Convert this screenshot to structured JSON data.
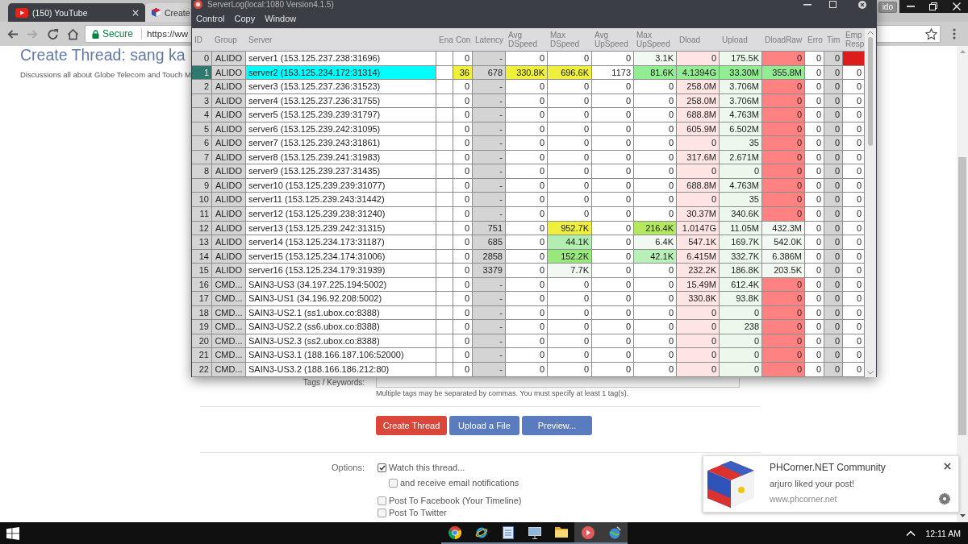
{
  "browser": {
    "tabs": [
      {
        "label": "(150) YouTube",
        "selected": false
      },
      {
        "label": "Create",
        "selected": true
      }
    ],
    "profile": "ido",
    "nav_buttons": [
      {
        "kind": "back",
        "disabled": false
      },
      {
        "kind": "forward",
        "disabled": true
      },
      {
        "kind": "reload",
        "disabled": false
      },
      {
        "kind": "home",
        "disabled": false
      }
    ],
    "address": {
      "security": "Secure",
      "url": "https://ww"
    }
  },
  "page": {
    "title": "Create Thread: sang ka",
    "description": "Discussions all about Globe Telecom and Touch M",
    "tags_label": "Tags / Keywords:",
    "tags_hint": "Multiple tags may be separated by commas. You must specify at least 1 tag(s).",
    "buttons": [
      {
        "label": "Create Thread",
        "kind": "primary"
      },
      {
        "label": "Upload a File",
        "kind": "secondary"
      },
      {
        "label": "Preview...",
        "kind": "secondary"
      }
    ],
    "options_label": "Options:",
    "options": [
      {
        "label": "Watch this thread...",
        "checked": true,
        "children": [
          {
            "label": "and receive email notifications",
            "checked": false
          }
        ]
      },
      {
        "label": "Post To Facebook (Your Timeline)",
        "checked": false
      },
      {
        "label": "Post To Twitter",
        "checked": false
      }
    ]
  },
  "serverlog": {
    "title": "ServerLog(local:1080 Version4.1.5)",
    "menu": [
      "Control",
      "Copy",
      "Window"
    ],
    "table": {
      "columns": [
        {
          "label": "ID",
          "kind": "index"
        },
        {
          "label": "Group",
          "kind": "label"
        },
        {
          "label": "Server",
          "kind": "text"
        },
        {
          "label": "Ena",
          "kind": "blank"
        },
        {
          "label": "Con",
          "kind": "number"
        },
        {
          "label": "Latency",
          "kind": "shaded"
        },
        {
          "label": "Avg DSpeed",
          "kind": "number"
        },
        {
          "label": "Max DSpeed",
          "kind": "number"
        },
        {
          "label": "Avg UpSpeed",
          "kind": "number"
        },
        {
          "label": "Max UpSpeed",
          "kind": "number"
        },
        {
          "label": "Dload",
          "kind": "number"
        },
        {
          "label": "Upload",
          "kind": "number"
        },
        {
          "label": "DloadRaw",
          "kind": "number"
        },
        {
          "label": "Erro",
          "kind": "number"
        },
        {
          "label": "Tim",
          "kind": "shaded"
        },
        {
          "label": "Emp Resp",
          "kind": "number"
        }
      ],
      "rows": [
        {
          "selected": false,
          "cells": [
            {
              "text": "0"
            },
            {
              "text": "ALIDO"
            },
            {
              "text": "server1 (153.125.237.238:31696)"
            },
            {
              "text": ""
            },
            {
              "text": "0"
            },
            {
              "text": "-"
            },
            {
              "text": "0"
            },
            {
              "text": "0"
            },
            {
              "text": "0"
            },
            {
              "text": "3.1K",
              "color": "#f2f9f2"
            },
            {
              "text": "0",
              "color": "#ffe4e4"
            },
            {
              "text": "175.5K",
              "color": "#ebf8eb"
            },
            {
              "text": "0",
              "color": "#ff8282"
            },
            {
              "text": "0"
            },
            {
              "text": "0"
            },
            {
              "color": "#dd1c1c"
            }
          ]
        },
        {
          "selected": true,
          "cells": [
            {
              "text": "1"
            },
            {
              "text": "ALIDO"
            },
            {
              "text": "server2 (153.125.234.172:31314)",
              "color": "#00ffff"
            },
            {
              "text": ""
            },
            {
              "text": "36",
              "color": "#eef03c"
            },
            {
              "text": "678"
            },
            {
              "text": "330.8K",
              "color": "#eef03c"
            },
            {
              "text": "696.6K",
              "color": "#eef03c"
            },
            {
              "text": "1173"
            },
            {
              "text": "81.6K",
              "color": "#92ec92"
            },
            {
              "text": "4.1394G",
              "color": "#92ec92"
            },
            {
              "text": "33.30M",
              "color": "#92ec92"
            },
            {
              "text": "355.8M",
              "color": "#92ec92"
            },
            {
              "text": "0"
            },
            {
              "text": "0"
            },
            {
              "text": "0"
            }
          ]
        },
        {
          "selected": false,
          "cells": [
            {
              "text": "2"
            },
            {
              "text": "ALIDO"
            },
            {
              "text": "server3 (153.125.237.236:31523)"
            },
            {
              "text": ""
            },
            {
              "text": "0"
            },
            {
              "text": "-"
            },
            {
              "text": "0"
            },
            {
              "text": "0"
            },
            {
              "text": "0"
            },
            {
              "text": "0"
            },
            {
              "text": "258.0M",
              "color": "#ffe4e4"
            },
            {
              "text": "3.706M",
              "color": "#ebf8eb"
            },
            {
              "text": "0",
              "color": "#ff8282"
            },
            {
              "text": "0"
            },
            {
              "text": "0"
            },
            {
              "text": "0"
            }
          ]
        },
        {
          "selected": false,
          "cells": [
            {
              "text": "3"
            },
            {
              "text": "ALIDO"
            },
            {
              "text": "server4 (153.125.237.236:31755)"
            },
            {
              "text": ""
            },
            {
              "text": "0"
            },
            {
              "text": "-"
            },
            {
              "text": "0"
            },
            {
              "text": "0"
            },
            {
              "text": "0"
            },
            {
              "text": "0"
            },
            {
              "text": "258.0M",
              "color": "#ffe4e4"
            },
            {
              "text": "3.706M",
              "color": "#ebf8eb"
            },
            {
              "text": "0",
              "color": "#ff8282"
            },
            {
              "text": "0"
            },
            {
              "text": "0"
            },
            {
              "text": "0"
            }
          ]
        },
        {
          "selected": false,
          "cells": [
            {
              "text": "4"
            },
            {
              "text": "ALIDO"
            },
            {
              "text": "server5 (153.125.239.239:31797)"
            },
            {
              "text": ""
            },
            {
              "text": "0"
            },
            {
              "text": "-"
            },
            {
              "text": "0"
            },
            {
              "text": "0"
            },
            {
              "text": "0"
            },
            {
              "text": "0"
            },
            {
              "text": "688.8M",
              "color": "#ffe4e4"
            },
            {
              "text": "4.763M",
              "color": "#ebf8eb"
            },
            {
              "text": "0",
              "color": "#ff8282"
            },
            {
              "text": "0"
            },
            {
              "text": "0"
            },
            {
              "text": "0"
            }
          ]
        },
        {
          "selected": false,
          "cells": [
            {
              "text": "5"
            },
            {
              "text": "ALIDO"
            },
            {
              "text": "server6 (153.125.239.242:31095)"
            },
            {
              "text": ""
            },
            {
              "text": "0"
            },
            {
              "text": "-"
            },
            {
              "text": "0"
            },
            {
              "text": "0"
            },
            {
              "text": "0"
            },
            {
              "text": "0"
            },
            {
              "text": "605.9M",
              "color": "#ffe4e4"
            },
            {
              "text": "6.502M",
              "color": "#ebf8eb"
            },
            {
              "text": "0",
              "color": "#ff8282"
            },
            {
              "text": "0"
            },
            {
              "text": "0"
            },
            {
              "text": "0"
            }
          ]
        },
        {
          "selected": false,
          "cells": [
            {
              "text": "6"
            },
            {
              "text": "ALIDO"
            },
            {
              "text": "server7 (153.125.239.243:31861)"
            },
            {
              "text": ""
            },
            {
              "text": "0"
            },
            {
              "text": "-"
            },
            {
              "text": "0"
            },
            {
              "text": "0"
            },
            {
              "text": "0"
            },
            {
              "text": "0"
            },
            {
              "text": "0",
              "color": "#ffe4e4"
            },
            {
              "text": "35",
              "color": "#ebf8eb"
            },
            {
              "text": "0",
              "color": "#ff8282"
            },
            {
              "text": "0"
            },
            {
              "text": "0"
            },
            {
              "text": "0"
            }
          ]
        },
        {
          "selected": false,
          "cells": [
            {
              "text": "7"
            },
            {
              "text": "ALIDO"
            },
            {
              "text": "server8 (153.125.239.241:31983)"
            },
            {
              "text": ""
            },
            {
              "text": "0"
            },
            {
              "text": "-"
            },
            {
              "text": "0"
            },
            {
              "text": "0"
            },
            {
              "text": "0"
            },
            {
              "text": "0"
            },
            {
              "text": "317.6M",
              "color": "#ffe4e4"
            },
            {
              "text": "2.671M",
              "color": "#ebf8eb"
            },
            {
              "text": "0",
              "color": "#ff8282"
            },
            {
              "text": "0"
            },
            {
              "text": "0"
            },
            {
              "text": "0"
            }
          ]
        },
        {
          "selected": false,
          "cells": [
            {
              "text": "8"
            },
            {
              "text": "ALIDO"
            },
            {
              "text": "server9 (153.125.239.237:31435)"
            },
            {
              "text": ""
            },
            {
              "text": "0"
            },
            {
              "text": "-"
            },
            {
              "text": "0"
            },
            {
              "text": "0"
            },
            {
              "text": "0"
            },
            {
              "text": "0"
            },
            {
              "text": "0",
              "color": "#ffe4e4"
            },
            {
              "text": "0",
              "color": "#ebf8eb"
            },
            {
              "text": "0",
              "color": "#ff8282"
            },
            {
              "text": "0"
            },
            {
              "text": "0"
            },
            {
              "text": "0"
            }
          ]
        },
        {
          "selected": false,
          "cells": [
            {
              "text": "9"
            },
            {
              "text": "ALIDO"
            },
            {
              "text": "server10 (153.125.239.239:31077)"
            },
            {
              "text": ""
            },
            {
              "text": "0"
            },
            {
              "text": "-"
            },
            {
              "text": "0"
            },
            {
              "text": "0"
            },
            {
              "text": "0"
            },
            {
              "text": "0"
            },
            {
              "text": "688.8M",
              "color": "#ffe4e4"
            },
            {
              "text": "4.763M",
              "color": "#ebf8eb"
            },
            {
              "text": "0",
              "color": "#ff8282"
            },
            {
              "text": "0"
            },
            {
              "text": "0"
            },
            {
              "text": "0"
            }
          ]
        },
        {
          "selected": false,
          "cells": [
            {
              "text": "10"
            },
            {
              "text": "ALIDO"
            },
            {
              "text": "server11 (153.125.239.243:31442)"
            },
            {
              "text": ""
            },
            {
              "text": "0"
            },
            {
              "text": "-"
            },
            {
              "text": "0"
            },
            {
              "text": "0"
            },
            {
              "text": "0"
            },
            {
              "text": "0"
            },
            {
              "text": "0",
              "color": "#ffe4e4"
            },
            {
              "text": "35",
              "color": "#ebf8eb"
            },
            {
              "text": "0",
              "color": "#ff8282"
            },
            {
              "text": "0"
            },
            {
              "text": "0"
            },
            {
              "text": "0"
            }
          ]
        },
        {
          "selected": false,
          "cells": [
            {
              "text": "11"
            },
            {
              "text": "ALIDO"
            },
            {
              "text": "server12 (153.125.239.238:31240)"
            },
            {
              "text": ""
            },
            {
              "text": "0"
            },
            {
              "text": "-"
            },
            {
              "text": "0"
            },
            {
              "text": "0"
            },
            {
              "text": "0"
            },
            {
              "text": "0"
            },
            {
              "text": "30.37M",
              "color": "#ffe4e4"
            },
            {
              "text": "340.6K",
              "color": "#ebf8eb"
            },
            {
              "text": "0",
              "color": "#ff8282"
            },
            {
              "text": "0"
            },
            {
              "text": "0"
            },
            {
              "text": "0"
            }
          ]
        },
        {
          "selected": false,
          "cells": [
            {
              "text": "12"
            },
            {
              "text": "ALIDO"
            },
            {
              "text": "server13 (153.125.239.242:31315)"
            },
            {
              "text": ""
            },
            {
              "text": "0"
            },
            {
              "text": "751"
            },
            {
              "text": "0"
            },
            {
              "text": "952.7K",
              "color": "#eef03c"
            },
            {
              "text": "0"
            },
            {
              "text": "216.4K",
              "color": "#b4e860"
            },
            {
              "text": "1.0147G",
              "color": "#ffe4e4"
            },
            {
              "text": "11.05M",
              "color": "#ebf8eb"
            },
            {
              "text": "432.3M",
              "color": "#f2f9f2"
            },
            {
              "text": "0"
            },
            {
              "text": "0"
            },
            {
              "text": "0"
            }
          ]
        },
        {
          "selected": false,
          "cells": [
            {
              "text": "13"
            },
            {
              "text": "ALIDO"
            },
            {
              "text": "server14 (153.125.234.173:31187)"
            },
            {
              "text": ""
            },
            {
              "text": "0"
            },
            {
              "text": "685"
            },
            {
              "text": "0"
            },
            {
              "text": "44.1K",
              "color": "#b2eeb2"
            },
            {
              "text": "0"
            },
            {
              "text": "6.4K",
              "color": "#f2f9f2"
            },
            {
              "text": "547.1K",
              "color": "#ffe4e4"
            },
            {
              "text": "169.7K",
              "color": "#ebf8eb"
            },
            {
              "text": "542.0K",
              "color": "#f2f9f2"
            },
            {
              "text": "0"
            },
            {
              "text": "0"
            },
            {
              "text": "0"
            }
          ]
        },
        {
          "selected": false,
          "cells": [
            {
              "text": "14"
            },
            {
              "text": "ALIDO"
            },
            {
              "text": "server15 (153.125.234.174:31006)"
            },
            {
              "text": ""
            },
            {
              "text": "0"
            },
            {
              "text": "2858"
            },
            {
              "text": "0"
            },
            {
              "text": "152.2K",
              "color": "#98e87c"
            },
            {
              "text": "0"
            },
            {
              "text": "42.1K",
              "color": "#b8f0b8"
            },
            {
              "text": "6.415M",
              "color": "#ffe4e4"
            },
            {
              "text": "332.7K",
              "color": "#ebf8eb"
            },
            {
              "text": "6.386M",
              "color": "#f2f9f2"
            },
            {
              "text": "0"
            },
            {
              "text": "0"
            },
            {
              "text": "0"
            }
          ]
        },
        {
          "selected": false,
          "cells": [
            {
              "text": "15"
            },
            {
              "text": "ALIDO"
            },
            {
              "text": "server16 (153.125.234.179:31939)"
            },
            {
              "text": ""
            },
            {
              "text": "0"
            },
            {
              "text": "3379"
            },
            {
              "text": "0"
            },
            {
              "text": "7.7K",
              "color": "#f2f9f2"
            },
            {
              "text": "0"
            },
            {
              "text": "0"
            },
            {
              "text": "232.2K",
              "color": "#ffe4e4"
            },
            {
              "text": "186.8K",
              "color": "#ebf8eb"
            },
            {
              "text": "203.5K",
              "color": "#f2f9f2"
            },
            {
              "text": "0"
            },
            {
              "text": "0"
            },
            {
              "text": "0"
            }
          ]
        },
        {
          "selected": false,
          "cells": [
            {
              "text": "16"
            },
            {
              "text": "CMD..."
            },
            {
              "text": "SAIN3-US3 (34.197.225.194:5002)"
            },
            {
              "text": ""
            },
            {
              "text": "0"
            },
            {
              "text": "-"
            },
            {
              "text": "0"
            },
            {
              "text": "0"
            },
            {
              "text": "0"
            },
            {
              "text": "0"
            },
            {
              "text": "15.49M",
              "color": "#ffe4e4"
            },
            {
              "text": "612.4K",
              "color": "#ebf8eb"
            },
            {
              "text": "0",
              "color": "#ff8282"
            },
            {
              "text": "0"
            },
            {
              "text": "0"
            },
            {
              "text": "0"
            }
          ]
        },
        {
          "selected": false,
          "cells": [
            {
              "text": "17"
            },
            {
              "text": "CMD..."
            },
            {
              "text": "SAIN3-US1 (34.196.92.208:5002)"
            },
            {
              "text": ""
            },
            {
              "text": "0"
            },
            {
              "text": "-"
            },
            {
              "text": "0"
            },
            {
              "text": "0"
            },
            {
              "text": "0"
            },
            {
              "text": "0"
            },
            {
              "text": "330.8K",
              "color": "#ffe4e4"
            },
            {
              "text": "93.8K",
              "color": "#ebf8eb"
            },
            {
              "text": "0",
              "color": "#ff8282"
            },
            {
              "text": "0"
            },
            {
              "text": "0"
            },
            {
              "text": "0"
            }
          ]
        },
        {
          "selected": false,
          "cells": [
            {
              "text": "18"
            },
            {
              "text": "CMD..."
            },
            {
              "text": "SAIN3-US2.1 (ss1.ubox.co:8388)"
            },
            {
              "text": ""
            },
            {
              "text": "0"
            },
            {
              "text": "-"
            },
            {
              "text": "0"
            },
            {
              "text": "0"
            },
            {
              "text": "0"
            },
            {
              "text": "0"
            },
            {
              "text": "0",
              "color": "#ffe4e4"
            },
            {
              "text": "0",
              "color": "#ebf8eb"
            },
            {
              "text": "0",
              "color": "#ff8282"
            },
            {
              "text": "0"
            },
            {
              "text": "0"
            },
            {
              "text": "0"
            }
          ]
        },
        {
          "selected": false,
          "cells": [
            {
              "text": "19"
            },
            {
              "text": "CMD..."
            },
            {
              "text": "SAIN3-US2.2 (ss6.ubox.co:8388)"
            },
            {
              "text": ""
            },
            {
              "text": "0"
            },
            {
              "text": "-"
            },
            {
              "text": "0"
            },
            {
              "text": "0"
            },
            {
              "text": "0"
            },
            {
              "text": "0"
            },
            {
              "text": "0",
              "color": "#ffe4e4"
            },
            {
              "text": "238",
              "color": "#ebf8eb"
            },
            {
              "text": "0",
              "color": "#ff8282"
            },
            {
              "text": "0"
            },
            {
              "text": "0"
            },
            {
              "text": "0"
            }
          ]
        },
        {
          "selected": false,
          "cells": [
            {
              "text": "20"
            },
            {
              "text": "CMD..."
            },
            {
              "text": "SAIN3-US2.3 (ss2.ubox.co:8388)"
            },
            {
              "text": ""
            },
            {
              "text": "0"
            },
            {
              "text": "-"
            },
            {
              "text": "0"
            },
            {
              "text": "0"
            },
            {
              "text": "0"
            },
            {
              "text": "0"
            },
            {
              "text": "0",
              "color": "#ffe4e4"
            },
            {
              "text": "0",
              "color": "#ebf8eb"
            },
            {
              "text": "0",
              "color": "#ff8282"
            },
            {
              "text": "0"
            },
            {
              "text": "0"
            },
            {
              "text": "0"
            }
          ]
        },
        {
          "selected": false,
          "cells": [
            {
              "text": "21"
            },
            {
              "text": "CMD..."
            },
            {
              "text": "SAIN3-US3.1 (188.166.187.106:52000)"
            },
            {
              "text": ""
            },
            {
              "text": "0"
            },
            {
              "text": "-"
            },
            {
              "text": "0"
            },
            {
              "text": "0"
            },
            {
              "text": "0"
            },
            {
              "text": "0"
            },
            {
              "text": "0",
              "color": "#ffe4e4"
            },
            {
              "text": "0",
              "color": "#ebf8eb"
            },
            {
              "text": "0",
              "color": "#ff8282"
            },
            {
              "text": "0"
            },
            {
              "text": "0"
            },
            {
              "text": "0"
            }
          ]
        },
        {
          "selected": false,
          "cells": [
            {
              "text": "22"
            },
            {
              "text": "CMD..."
            },
            {
              "text": "SAIN3-US3.2 (188.166.186.212:80)"
            },
            {
              "text": ""
            },
            {
              "text": "0"
            },
            {
              "text": "-"
            },
            {
              "text": "0"
            },
            {
              "text": "0"
            },
            {
              "text": "0"
            },
            {
              "text": "0"
            },
            {
              "text": "0",
              "color": "#ffe4e4"
            },
            {
              "text": "0",
              "color": "#ebf8eb"
            },
            {
              "text": "0",
              "color": "#ff8282"
            },
            {
              "text": "0"
            },
            {
              "text": "0"
            },
            {
              "text": "0"
            }
          ]
        }
      ]
    }
  },
  "notification": {
    "title": "PHCorner.NET Community",
    "message": "arjuro liked your post!",
    "source": "www.phcorner.net"
  },
  "taskbar": {
    "apps": [
      {
        "running": true,
        "highlighted": false
      },
      {
        "running": true,
        "highlighted": false
      },
      {
        "running": true,
        "highlighted": false
      },
      {
        "running": true,
        "highlighted": false
      },
      {
        "running": true,
        "highlighted": false
      },
      {
        "running": true,
        "highlighted": true
      },
      {
        "running": true,
        "highlighted": true
      }
    ],
    "time": "12:11 AM"
  }
}
